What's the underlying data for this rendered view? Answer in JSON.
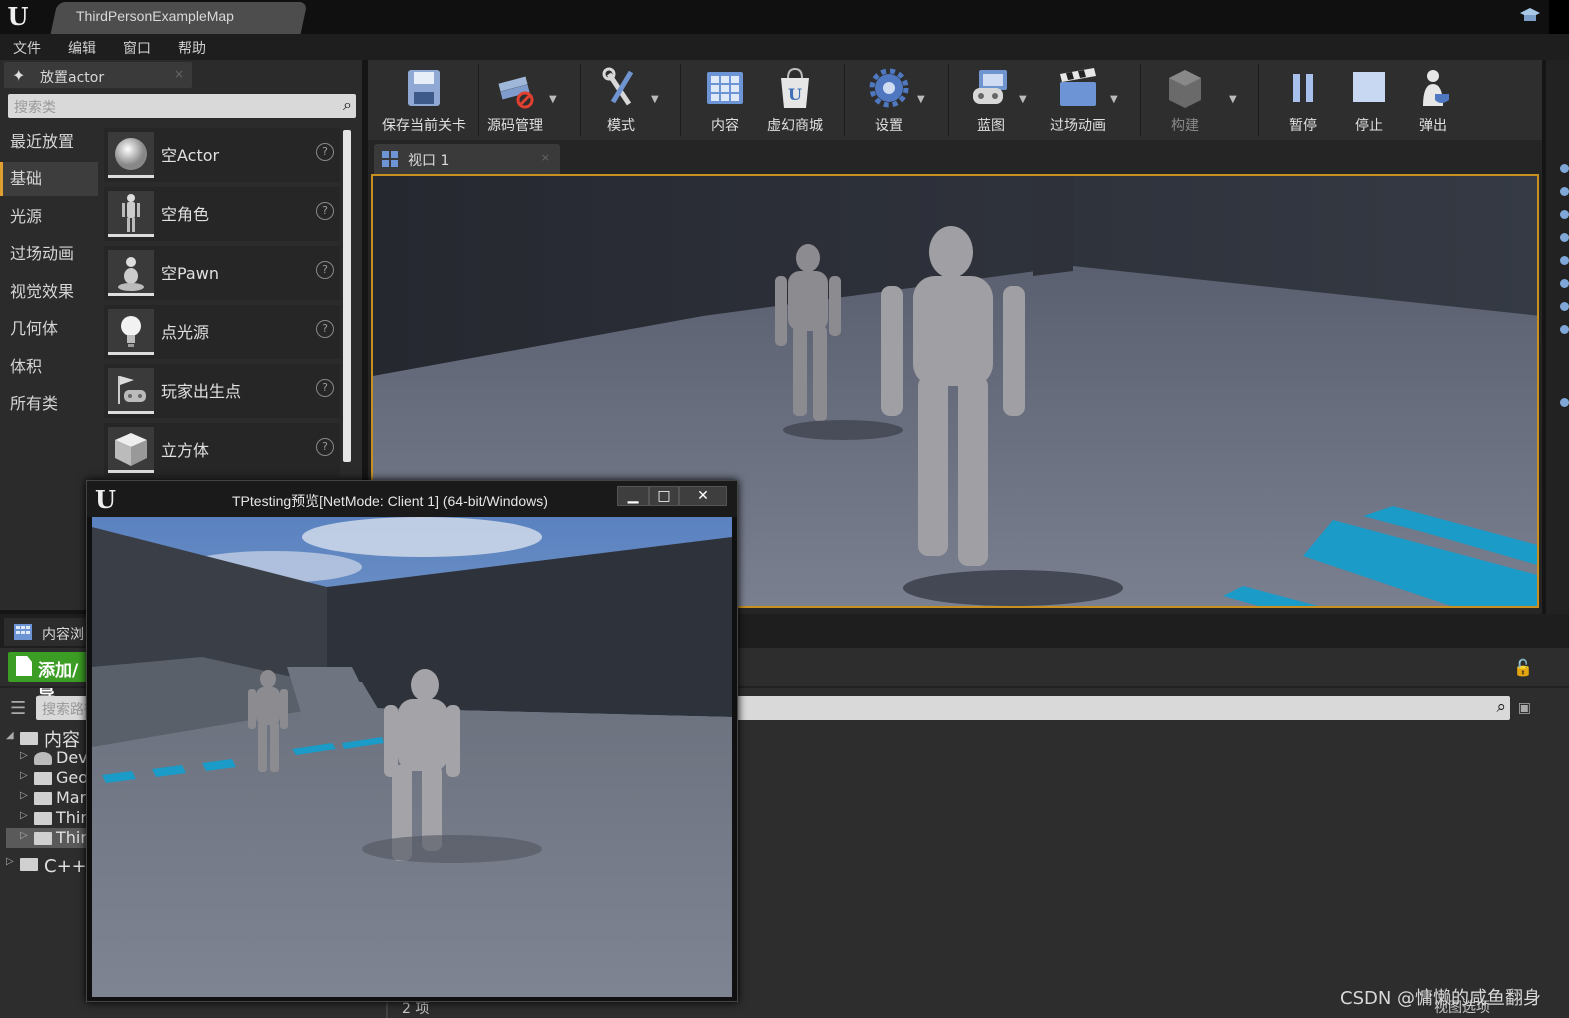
{
  "window": {
    "map_tab": "ThirdPersonExampleMap",
    "logo": "U"
  },
  "menu": [
    "文件",
    "编辑",
    "窗口",
    "帮助"
  ],
  "place_panel": {
    "tab_label": "放置actor",
    "search_placeholder": "搜索类",
    "categories": [
      "最近放置",
      "基础",
      "光源",
      "过场动画",
      "视觉效果",
      "几何体",
      "体积",
      "所有类"
    ],
    "active_category": "基础",
    "items": [
      {
        "label": "空Actor",
        "icon": "sphere-icon"
      },
      {
        "label": "空角色",
        "icon": "mannequin-icon"
      },
      {
        "label": "空Pawn",
        "icon": "pawn-icon"
      },
      {
        "label": "点光源",
        "icon": "lightbulb-icon"
      },
      {
        "label": "玩家出生点",
        "icon": "player-start-icon"
      },
      {
        "label": "立方体",
        "icon": "cube-icon"
      }
    ],
    "help_glyph": "?"
  },
  "toolbar": {
    "buttons": [
      {
        "label": "保存当前关卡",
        "icon": "save-icon"
      },
      {
        "label": "源码管理",
        "icon": "source-control-icon"
      },
      {
        "label": "模式",
        "icon": "modes-icon"
      },
      {
        "label": "内容",
        "icon": "content-icon"
      },
      {
        "label": "虚幻商城",
        "icon": "marketplace-icon"
      },
      {
        "label": "设置",
        "icon": "settings-icon"
      },
      {
        "label": "蓝图",
        "icon": "blueprint-icon"
      },
      {
        "label": "过场动画",
        "icon": "cinematics-icon"
      },
      {
        "label": "构建",
        "icon": "build-icon"
      },
      {
        "label": "暂停",
        "icon": "pause-icon"
      },
      {
        "label": "停止",
        "icon": "stop-icon"
      },
      {
        "label": "弹出",
        "icon": "eject-icon"
      }
    ]
  },
  "viewport": {
    "tab_label": "视口 1",
    "border_color": "#c89020"
  },
  "content_browser": {
    "tab_label": "内容浏",
    "add_label": "添加/导",
    "search_placeholder": "搜索路径",
    "tree": [
      {
        "label": "内容",
        "icon": "folder-open-icon"
      },
      {
        "label": "Dev",
        "icon": "user-folder-icon"
      },
      {
        "label": "Geo",
        "icon": "folder-icon"
      },
      {
        "label": "Mar",
        "icon": "folder-icon"
      },
      {
        "label": "Thir",
        "icon": "folder-icon"
      },
      {
        "label": "Thir",
        "icon": "folder-icon"
      },
      {
        "label": "C++类",
        "icon": "cpp-folder-icon"
      }
    ],
    "item_count": "2 项",
    "view_options": "视图选项"
  },
  "preview_window": {
    "title": "TPtesting预览[NetMode: Client 1]  (64-bit/Windows)",
    "minimize": "▁",
    "maximize": "□",
    "close": "✕"
  },
  "watermark": "CSDN @慵懒的咸鱼翻身",
  "colors": {
    "accent_orange": "#c89020",
    "add_green": "#3b9d24",
    "floor_stripes": "#1a9bc8"
  }
}
